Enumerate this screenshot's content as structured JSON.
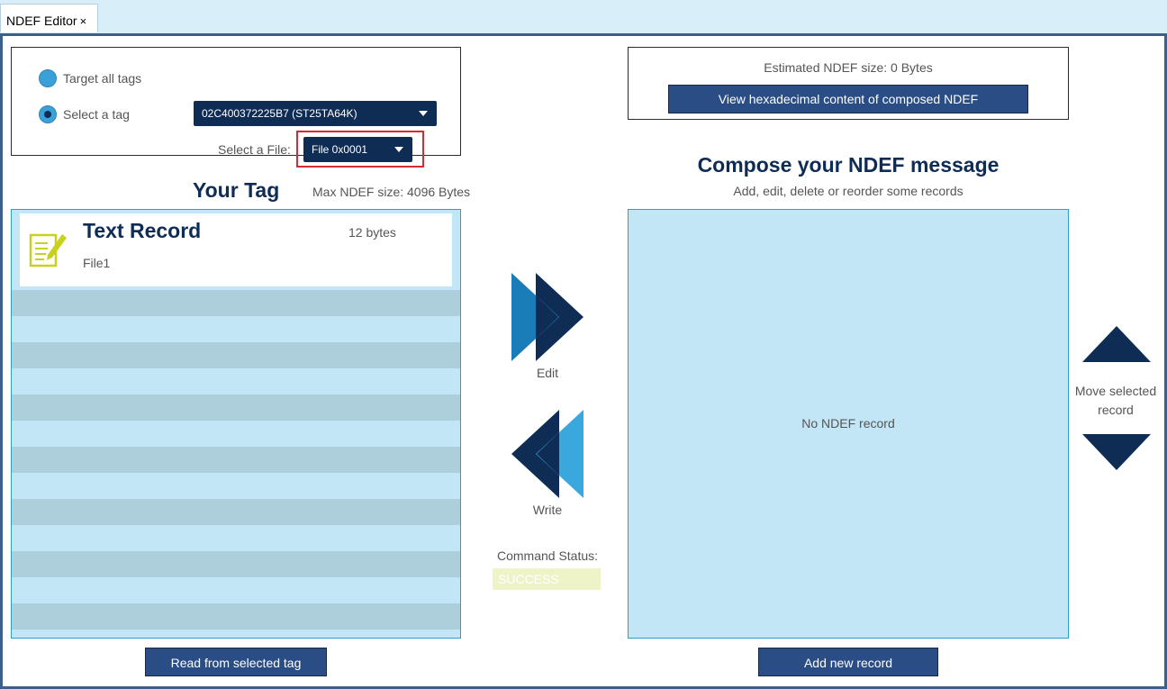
{
  "tab": {
    "title": "NDEF Editor",
    "close": "×"
  },
  "target": {
    "all_tags_label": "Target all tags",
    "select_tag_label": "Select a tag",
    "selected_tag": "02C400372225B7 (ST25TA64K)",
    "select_file_label": "Select a File:",
    "selected_file": "File 0x0001"
  },
  "estimate": {
    "text": "Estimated NDEF size: 0 Bytes",
    "view_hex_label": "View hexadecimal content of composed NDEF"
  },
  "your_tag": {
    "title": "Your Tag",
    "max_size": "Max NDEF size: 4096 Bytes",
    "records": [
      {
        "title": "Text Record",
        "size": "12 bytes",
        "subtitle": "File1",
        "icon": "text-record-icon"
      }
    ],
    "read_button": "Read from selected tag"
  },
  "actions": {
    "edit_label": "Edit",
    "write_label": "Write",
    "command_status_label": "Command Status:",
    "command_status_value": "SUCCESS"
  },
  "compose": {
    "title": "Compose your NDEF message",
    "subtitle": "Add, edit, delete or reorder some records",
    "empty_text": "No NDEF record",
    "add_button": "Add new record",
    "move_label": "Move selected record"
  },
  "colors": {
    "navy": "#0f2c55",
    "button": "#2a4d85",
    "list_bg": "#c2e6f5",
    "stripe": "#adcfdc",
    "highlight": "#d82a35",
    "status_bg": "#eef4c8",
    "icon_yellow": "#c8d21e"
  }
}
